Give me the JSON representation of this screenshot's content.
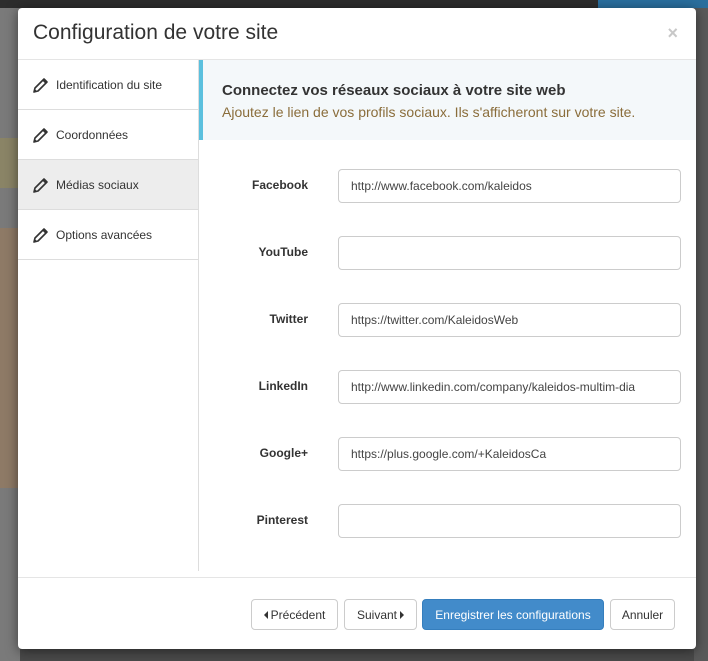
{
  "modal": {
    "title": "Configuration de votre site",
    "close_label": "×"
  },
  "sidebar": {
    "items": [
      {
        "label": "Identification du site",
        "icon": "pencil-icon",
        "active": false
      },
      {
        "label": "Coordonnées",
        "icon": "pencil-icon",
        "active": false
      },
      {
        "label": "Médias sociaux",
        "icon": "pencil-icon",
        "active": true
      },
      {
        "label": "Options avancées",
        "icon": "pencil-icon",
        "active": false
      }
    ]
  },
  "callout": {
    "title": "Connectez vos réseaux sociaux à votre site web",
    "subtitle": "Ajoutez le lien de vos profils sociaux. Ils s'afficheront sur votre site."
  },
  "form": {
    "fields": [
      {
        "label": "Facebook",
        "value": "http://www.facebook.com/kaleidos"
      },
      {
        "label": "YouTube",
        "value": ""
      },
      {
        "label": "Twitter",
        "value": "https://twitter.com/KaleidosWeb"
      },
      {
        "label": "LinkedIn",
        "value": "http://www.linkedin.com/company/kaleidos-multim-dia"
      },
      {
        "label": "Google+",
        "value": "https://plus.google.com/+KaleidosCa"
      },
      {
        "label": "Pinterest",
        "value": ""
      }
    ]
  },
  "footer": {
    "prev_label": "Précédent",
    "next_label": "Suivant",
    "save_label": "Enregistrer les configurations",
    "cancel_label": "Annuler"
  },
  "colors": {
    "primary": "#428bca",
    "callout_border": "#5bc0de",
    "callout_subtitle": "#8a6d3b",
    "active_tab_bg": "#ededed"
  }
}
